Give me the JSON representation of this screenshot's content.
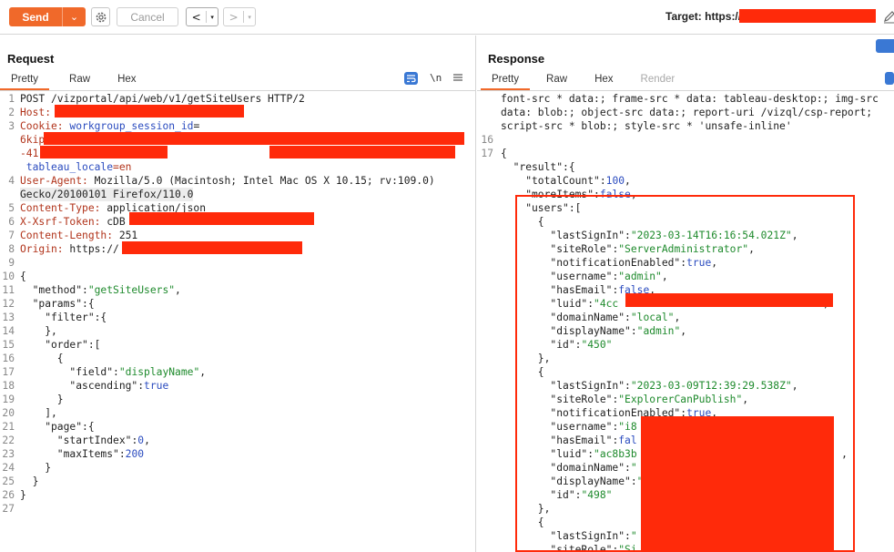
{
  "toolbar": {
    "send_label": "Send",
    "send_dropdown_glyph": "⌄",
    "cancel_label": "Cancel",
    "back_glyph": "<",
    "forward_glyph": ">",
    "caret_glyph": "▾",
    "target_label": "Target: https://"
  },
  "request": {
    "title": "Request",
    "tabs": [
      "Pretty",
      "Raw",
      "Hex"
    ],
    "active_tab": "Pretty",
    "newline_toggle": "\\n",
    "lines": [
      {
        "n": "1",
        "parts": [
          {
            "t": "POST /vizportal/api/web/v1/getSiteUsers HTTP/2",
            "c": ""
          }
        ]
      },
      {
        "n": "2",
        "parts": [
          {
            "t": "Host: ",
            "c": "k"
          }
        ]
      },
      {
        "n": "3",
        "parts": [
          {
            "t": "Cookie: ",
            "c": "k"
          },
          {
            "t": "workgroup_session_id",
            "c": "c"
          },
          {
            "t": "=",
            "c": ""
          }
        ]
      },
      {
        "n": "",
        "parts": [
          {
            "t": "6kip",
            "c": "k"
          }
        ]
      },
      {
        "n": "",
        "parts": [
          {
            "t": "-41",
            "c": "k"
          },
          {
            "t": "                                                  ",
            "c": ""
          },
          {
            "t": "; ",
            "c": ""
          },
          {
            "t": "XSRF-TOKEN",
            "c": "c"
          },
          {
            "t": "=cDB",
            "c": "k"
          }
        ]
      },
      {
        "n": "",
        "parts": [
          {
            "t": " ",
            "c": ""
          },
          {
            "t": "tableau_locale",
            "c": "c"
          },
          {
            "t": "=en",
            "c": "k"
          }
        ]
      },
      {
        "n": "4",
        "parts": [
          {
            "t": "User-Agent: ",
            "c": "k"
          },
          {
            "t": "Mozilla/5.0 (Macintosh; Intel Mac OS X 10.15; rv:109.0)",
            "c": ""
          }
        ]
      },
      {
        "n": "",
        "hl": true,
        "parts": [
          {
            "t": "Gecko/20100101 Firefox/110.0",
            "c": ""
          }
        ]
      },
      {
        "n": "5",
        "parts": [
          {
            "t": "Content-Type: ",
            "c": "k"
          },
          {
            "t": "application/json",
            "c": ""
          }
        ]
      },
      {
        "n": "6",
        "parts": [
          {
            "t": "X-Xsrf-Token: ",
            "c": "k"
          },
          {
            "t": "cDB",
            "c": ""
          }
        ]
      },
      {
        "n": "7",
        "parts": [
          {
            "t": "Content-Length: ",
            "c": "k"
          },
          {
            "t": "251",
            "c": ""
          }
        ]
      },
      {
        "n": "8",
        "parts": [
          {
            "t": "Origin: ",
            "c": "k"
          },
          {
            "t": "https://",
            "c": ""
          }
        ]
      },
      {
        "n": "9",
        "parts": []
      },
      {
        "n": "10",
        "parts": [
          {
            "t": "{",
            "c": ""
          }
        ]
      },
      {
        "n": "11",
        "parts": [
          {
            "t": "  \"method\"",
            "c": "j"
          },
          {
            "t": ":",
            "c": ""
          },
          {
            "t": "\"getSiteUsers\"",
            "c": "s"
          },
          {
            "t": ",",
            "c": ""
          }
        ]
      },
      {
        "n": "12",
        "parts": [
          {
            "t": "  \"params\"",
            "c": "j"
          },
          {
            "t": ":{",
            "c": ""
          }
        ]
      },
      {
        "n": "13",
        "parts": [
          {
            "t": "    \"filter\"",
            "c": "j"
          },
          {
            "t": ":{",
            "c": ""
          }
        ]
      },
      {
        "n": "14",
        "parts": [
          {
            "t": "    },",
            "c": ""
          }
        ]
      },
      {
        "n": "15",
        "parts": [
          {
            "t": "    \"order\"",
            "c": "j"
          },
          {
            "t": ":[",
            "c": ""
          }
        ]
      },
      {
        "n": "16",
        "parts": [
          {
            "t": "      {",
            "c": ""
          }
        ]
      },
      {
        "n": "17",
        "parts": [
          {
            "t": "        \"field\"",
            "c": "j"
          },
          {
            "t": ":",
            "c": ""
          },
          {
            "t": "\"displayName\"",
            "c": "s"
          },
          {
            "t": ",",
            "c": ""
          }
        ]
      },
      {
        "n": "18",
        "parts": [
          {
            "t": "        \"ascending\"",
            "c": "j"
          },
          {
            "t": ":",
            "c": ""
          },
          {
            "t": "true",
            "c": "n"
          }
        ]
      },
      {
        "n": "19",
        "parts": [
          {
            "t": "      }",
            "c": ""
          }
        ]
      },
      {
        "n": "20",
        "parts": [
          {
            "t": "    ],",
            "c": ""
          }
        ]
      },
      {
        "n": "21",
        "parts": [
          {
            "t": "    \"page\"",
            "c": "j"
          },
          {
            "t": ":{",
            "c": ""
          }
        ]
      },
      {
        "n": "22",
        "parts": [
          {
            "t": "      \"startIndex\"",
            "c": "j"
          },
          {
            "t": ":",
            "c": ""
          },
          {
            "t": "0",
            "c": "n"
          },
          {
            "t": ",",
            "c": ""
          }
        ]
      },
      {
        "n": "23",
        "parts": [
          {
            "t": "      \"maxItems\"",
            "c": "j"
          },
          {
            "t": ":",
            "c": ""
          },
          {
            "t": "200",
            "c": "n"
          }
        ]
      },
      {
        "n": "24",
        "parts": [
          {
            "t": "    }",
            "c": ""
          }
        ]
      },
      {
        "n": "25",
        "parts": [
          {
            "t": "  }",
            "c": ""
          }
        ]
      },
      {
        "n": "26",
        "parts": [
          {
            "t": "}",
            "c": ""
          }
        ]
      },
      {
        "n": "27",
        "parts": []
      }
    ]
  },
  "response": {
    "title": "Response",
    "tabs": [
      "Pretty",
      "Raw",
      "Hex",
      "Render"
    ],
    "active_tab": "Pretty",
    "disabled_tab": "Render",
    "lines": [
      {
        "n": "",
        "parts": [
          {
            "t": "font-src * data:; frame-src * data: tableau-desktop:; img-src",
            "c": ""
          }
        ]
      },
      {
        "n": "",
        "parts": [
          {
            "t": "data: blob:; object-src data:; report-uri /vizql/csp-report;",
            "c": ""
          }
        ]
      },
      {
        "n": "",
        "parts": [
          {
            "t": "script-src * blob:; style-src * 'unsafe-inline'",
            "c": ""
          }
        ]
      },
      {
        "n": "16",
        "parts": []
      },
      {
        "n": "17",
        "parts": [
          {
            "t": "{",
            "c": ""
          }
        ]
      },
      {
        "n": "",
        "parts": [
          {
            "t": "  \"result\"",
            "c": "j"
          },
          {
            "t": ":{",
            "c": ""
          }
        ]
      },
      {
        "n": "",
        "parts": [
          {
            "t": "    \"totalCount\"",
            "c": "j"
          },
          {
            "t": ":",
            "c": ""
          },
          {
            "t": "100",
            "c": "n"
          },
          {
            "t": ",",
            "c": ""
          }
        ]
      },
      {
        "n": "",
        "parts": [
          {
            "t": "    \"moreItems\"",
            "c": "j"
          },
          {
            "t": ":",
            "c": ""
          },
          {
            "t": "false",
            "c": "n"
          },
          {
            "t": ",",
            "c": ""
          }
        ]
      },
      {
        "n": "",
        "parts": [
          {
            "t": "    \"users\"",
            "c": "j"
          },
          {
            "t": ":[",
            "c": ""
          }
        ]
      },
      {
        "n": "",
        "parts": [
          {
            "t": "      {",
            "c": ""
          }
        ]
      },
      {
        "n": "",
        "parts": [
          {
            "t": "        \"lastSignIn\"",
            "c": "j"
          },
          {
            "t": ":",
            "c": ""
          },
          {
            "t": "\"2023-03-14T16:16:54.021Z\"",
            "c": "s"
          },
          {
            "t": ",",
            "c": ""
          }
        ]
      },
      {
        "n": "",
        "parts": [
          {
            "t": "        \"siteRole\"",
            "c": "j"
          },
          {
            "t": ":",
            "c": ""
          },
          {
            "t": "\"ServerAdministrator\"",
            "c": "s"
          },
          {
            "t": ",",
            "c": ""
          }
        ]
      },
      {
        "n": "",
        "parts": [
          {
            "t": "        \"notificationEnabled\"",
            "c": "j"
          },
          {
            "t": ":",
            "c": ""
          },
          {
            "t": "true",
            "c": "n"
          },
          {
            "t": ",",
            "c": ""
          }
        ]
      },
      {
        "n": "",
        "parts": [
          {
            "t": "        \"username\"",
            "c": "j"
          },
          {
            "t": ":",
            "c": ""
          },
          {
            "t": "\"admin\"",
            "c": "s"
          },
          {
            "t": ",",
            "c": ""
          }
        ]
      },
      {
        "n": "",
        "parts": [
          {
            "t": "        \"hasEmail\"",
            "c": "j"
          },
          {
            "t": ":",
            "c": ""
          },
          {
            "t": "false",
            "c": "n"
          },
          {
            "t": ",",
            "c": ""
          }
        ]
      },
      {
        "n": "",
        "parts": [
          {
            "t": "        \"luid\"",
            "c": "j"
          },
          {
            "t": ":",
            "c": ""
          },
          {
            "t": "\"4cc",
            "c": "s"
          },
          {
            "t": "                                \"",
            "c": "s"
          },
          {
            "t": ",",
            "c": ""
          }
        ]
      },
      {
        "n": "",
        "parts": [
          {
            "t": "        \"domainName\"",
            "c": "j"
          },
          {
            "t": ":",
            "c": ""
          },
          {
            "t": "\"local\"",
            "c": "s"
          },
          {
            "t": ",",
            "c": ""
          }
        ]
      },
      {
        "n": "",
        "parts": [
          {
            "t": "        \"displayName\"",
            "c": "j"
          },
          {
            "t": ":",
            "c": ""
          },
          {
            "t": "\"admin\"",
            "c": "s"
          },
          {
            "t": ",",
            "c": ""
          }
        ]
      },
      {
        "n": "",
        "parts": [
          {
            "t": "        \"id\"",
            "c": "j"
          },
          {
            "t": ":",
            "c": ""
          },
          {
            "t": "\"450\"",
            "c": "s"
          }
        ]
      },
      {
        "n": "",
        "parts": [
          {
            "t": "      },",
            "c": ""
          }
        ]
      },
      {
        "n": "",
        "parts": [
          {
            "t": "      {",
            "c": ""
          }
        ]
      },
      {
        "n": "",
        "parts": [
          {
            "t": "        \"lastSignIn\"",
            "c": "j"
          },
          {
            "t": ":",
            "c": ""
          },
          {
            "t": "\"2023-03-09T12:39:29.538Z\"",
            "c": "s"
          },
          {
            "t": ",",
            "c": ""
          }
        ]
      },
      {
        "n": "",
        "parts": [
          {
            "t": "        \"siteRole\"",
            "c": "j"
          },
          {
            "t": ":",
            "c": ""
          },
          {
            "t": "\"ExplorerCanPublish\"",
            "c": "s"
          },
          {
            "t": ",",
            "c": ""
          }
        ]
      },
      {
        "n": "",
        "parts": [
          {
            "t": "        \"notificationEnabled\"",
            "c": "j"
          },
          {
            "t": ":",
            "c": ""
          },
          {
            "t": "true",
            "c": "n"
          },
          {
            "t": ",",
            "c": ""
          }
        ]
      },
      {
        "n": "",
        "parts": [
          {
            "t": "        \"username\"",
            "c": "j"
          },
          {
            "t": ":",
            "c": ""
          },
          {
            "t": "\"i8",
            "c": "s"
          }
        ]
      },
      {
        "n": "",
        "parts": [
          {
            "t": "        \"hasEmail\"",
            "c": "j"
          },
          {
            "t": ":",
            "c": ""
          },
          {
            "t": "fal",
            "c": "n"
          }
        ]
      },
      {
        "n": "",
        "parts": [
          {
            "t": "        \"luid\"",
            "c": "j"
          },
          {
            "t": ":",
            "c": ""
          },
          {
            "t": "\"ac8b3b",
            "c": "s"
          },
          {
            "t": "                                 ",
            "c": ""
          },
          {
            "t": ",",
            "c": ""
          }
        ]
      },
      {
        "n": "",
        "parts": [
          {
            "t": "        \"domainName\"",
            "c": "j"
          },
          {
            "t": ":",
            "c": ""
          },
          {
            "t": "\"",
            "c": "s"
          }
        ]
      },
      {
        "n": "",
        "parts": [
          {
            "t": "        \"displayName\"",
            "c": "j"
          },
          {
            "t": ":",
            "c": ""
          },
          {
            "t": "\"",
            "c": "s"
          }
        ]
      },
      {
        "n": "",
        "parts": [
          {
            "t": "        \"id\"",
            "c": "j"
          },
          {
            "t": ":",
            "c": ""
          },
          {
            "t": "\"498\"",
            "c": "s"
          }
        ]
      },
      {
        "n": "",
        "parts": [
          {
            "t": "      },",
            "c": ""
          }
        ]
      },
      {
        "n": "",
        "parts": [
          {
            "t": "      {",
            "c": ""
          }
        ]
      },
      {
        "n": "",
        "parts": [
          {
            "t": "        \"lastSignIn\"",
            "c": "j"
          },
          {
            "t": ":",
            "c": ""
          },
          {
            "t": "\"",
            "c": "s"
          }
        ]
      },
      {
        "n": "",
        "parts": [
          {
            "t": "        \"siteRole\"",
            "c": "j"
          },
          {
            "t": ":",
            "c": ""
          },
          {
            "t": "\"Si",
            "c": "s"
          }
        ]
      }
    ]
  },
  "colors": {
    "accent": "#f0692a",
    "redaction": "#ff2a0a",
    "icon_blue": "#3a78d4"
  },
  "icons": {
    "settings": "gear-icon",
    "edit_target": "pencil-icon",
    "word_wrap": "wrap-icon",
    "menu": "menu-icon",
    "layout": "layout-toggle-icon"
  }
}
